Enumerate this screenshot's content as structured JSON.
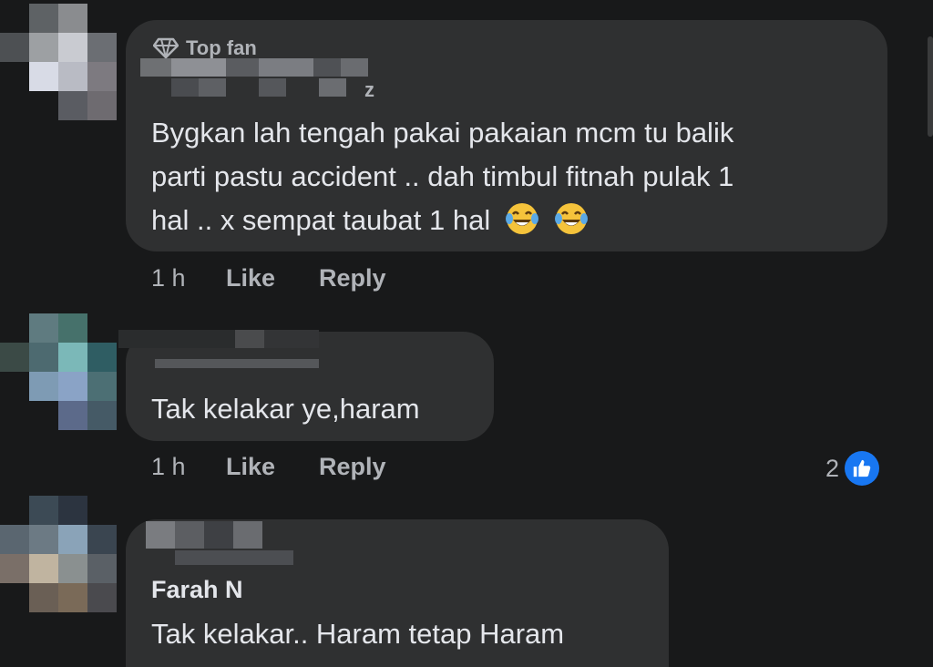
{
  "comments": [
    {
      "badge": "Top fan",
      "name_suffix": "z",
      "text_lines": [
        "Bygkan lah tengah pakai pakaian mcm tu balik",
        "parti pastu accident .. dah timbul fitnah pulak 1",
        "hal .. x sempat taubat 1 hal"
      ],
      "emojis": [
        "face-with-tears-of-joy",
        "face-with-tears-of-joy"
      ],
      "time": "1 h",
      "like_label": "Like",
      "reply_label": "Reply"
    },
    {
      "text": "Tak kelakar ye,haram",
      "time": "1 h",
      "like_label": "Like",
      "reply_label": "Reply",
      "reaction_count": "2",
      "reaction_icon": "thumbs-up-icon"
    },
    {
      "author": "Farah N",
      "text": "Tak kelakar.. Haram tetap Haram"
    }
  ],
  "colors": {
    "background": "#18191a",
    "bubble": "#2f3031",
    "text": "#e4e6eb",
    "muted": "#b0b3b8",
    "like_blue": "#1877f2"
  }
}
